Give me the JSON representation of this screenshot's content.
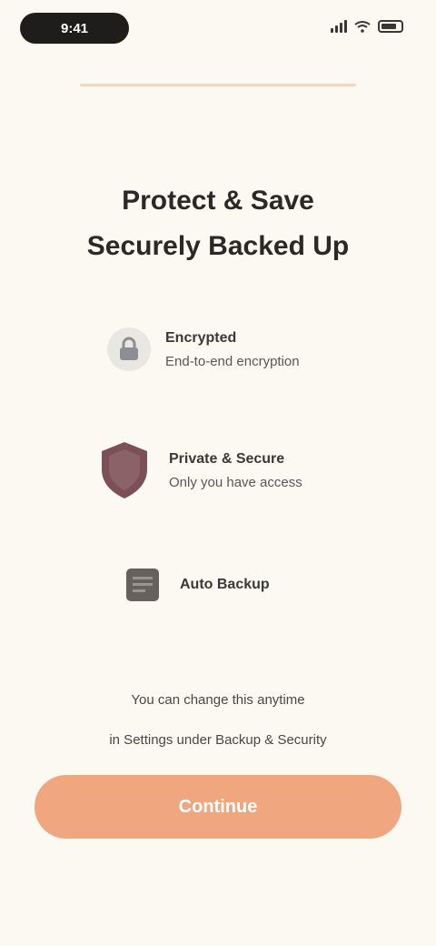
{
  "status_bar": {
    "time": "9:41"
  },
  "headline": {
    "line1": "Protect & Save",
    "line2": "Securely Backed Up"
  },
  "features": [
    {
      "title": "Encrypted",
      "subtitle": "End-to-end encryption",
      "icon": "lock-icon",
      "icon_color": "#8c8e94"
    },
    {
      "title": "Private & Secure",
      "subtitle": "Only you have access",
      "icon": "shield-icon",
      "icon_color": "#7d4f57"
    },
    {
      "title": "Auto Backup",
      "subtitle": "",
      "icon": "document-icon",
      "icon_color": "#67615e"
    }
  ],
  "footnote": {
    "line1": "You can change this anytime",
    "line2": "in Settings under Backup & Security"
  },
  "cta": {
    "label": "Continue"
  },
  "colors": {
    "background": "#fcf9f2",
    "accent": "#f0a780",
    "divider": "#f2d8c4",
    "text": "#2a2624"
  }
}
